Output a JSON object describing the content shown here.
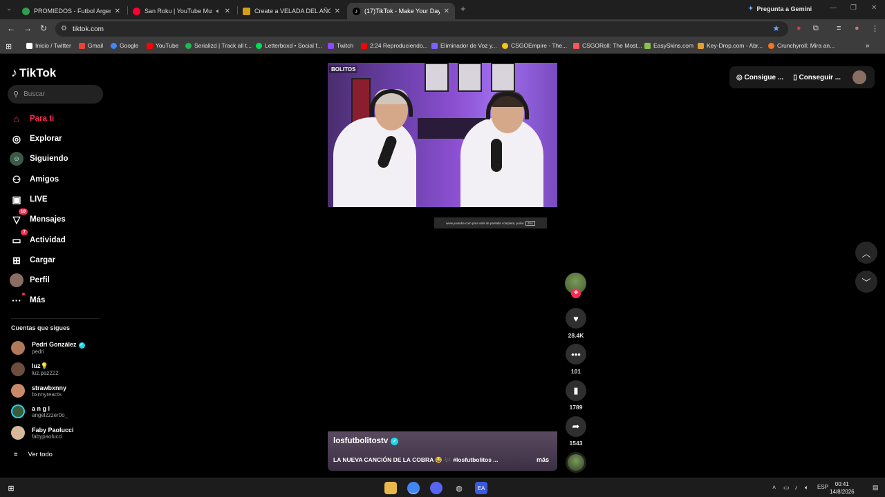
{
  "browser": {
    "tabs": [
      {
        "title": "PROMIEDOS - Futbol Argentino",
        "color": "#2e9e4f",
        "active": false
      },
      {
        "title": "San Roku | YouTube Music",
        "color": "#ff0033",
        "active": false
      },
      {
        "title": "Create a VELADA DEL AÑO #Pe",
        "color": "#d4a017",
        "active": false
      },
      {
        "title": "(17)TikTok - Make Your Day",
        "color": "#ffffff",
        "active": true
      }
    ],
    "new_tab": "+",
    "gemini_label": "Pregunta a Gemini",
    "url": "tiktok.com",
    "bookmarks": [
      {
        "label": "Inicio / Twitter",
        "color": "#ffffff"
      },
      {
        "label": "Gmail",
        "color": "#ea4335"
      },
      {
        "label": "Google",
        "color": "#4285f4"
      },
      {
        "label": "YouTube",
        "color": "#ff0000"
      },
      {
        "label": "Serializd | Track all t...",
        "color": "#1db954"
      },
      {
        "label": "Letterboxd • Social f...",
        "color": "#00e054"
      },
      {
        "label": "Twitch",
        "color": "#9146ff"
      },
      {
        "label": "2:24 Reproduciendo...",
        "color": "#ff0000"
      },
      {
        "label": "Eliminador de Voz y...",
        "color": "#7b61ff"
      },
      {
        "label": "CSGOEmpire - The...",
        "color": "#f5c518"
      },
      {
        "label": "CSGORoll: The Most...",
        "color": "#ff5555"
      },
      {
        "label": "EasySkins.com",
        "color": "#8bc34a"
      },
      {
        "label": "Key-Drop.com - Abr...",
        "color": "#e0a030"
      },
      {
        "label": "Crunchyroll: Mira an...",
        "color": "#f47521"
      }
    ]
  },
  "tiktok": {
    "logo": "TikTok",
    "search_placeholder": "Buscar",
    "nav": [
      {
        "label": "Para ti",
        "icon": "home-icon",
        "active": true
      },
      {
        "label": "Explorar",
        "icon": "compass-icon"
      },
      {
        "label": "Siguiendo",
        "icon": "following-icon"
      },
      {
        "label": "Amigos",
        "icon": "friends-icon"
      },
      {
        "label": "LIVE",
        "icon": "live-icon"
      },
      {
        "label": "Mensajes",
        "icon": "messages-icon",
        "badge": "10"
      },
      {
        "label": "Actividad",
        "icon": "activity-icon",
        "badge": "7"
      },
      {
        "label": "Cargar",
        "icon": "upload-icon"
      },
      {
        "label": "Perfil",
        "icon": "profile-icon"
      },
      {
        "label": "Más",
        "icon": "more-icon"
      }
    ],
    "following_title": "Cuentas que sigues",
    "following": [
      {
        "name": "Pedri González",
        "handle": "pedri",
        "verified": true,
        "color": "#b07a5a"
      },
      {
        "name": "luz💡",
        "handle": "luz.paz222",
        "verified": false,
        "color": "#6b4e3d"
      },
      {
        "name": "strawbxnny",
        "handle": "bxnnyreacts",
        "verified": false,
        "color": "#c98a6a"
      },
      {
        "name": "a n g l",
        "handle": "angelzzzer0o_",
        "verified": false,
        "color": "#3a5a3a"
      },
      {
        "name": "Faby Paolucci",
        "handle": "fabypaolucci",
        "verified": false,
        "color": "#d8b89a"
      }
    ],
    "see_all": "Ver todo",
    "video": {
      "watermark": "BOLITOS",
      "esc_hint": "www.youtube.com para salir de pantalla completa, pulsa",
      "esc_key": "Esc",
      "author": "losfutbolitostv",
      "caption": "LA NUEVA CANCIÓN DE LA COBRA 😂 🎶 #losfutbolitos ...",
      "more": "más",
      "likes": "28.4K",
      "comments": "101",
      "saves": "1789",
      "shares": "1543"
    },
    "topbar": {
      "coins": "Consigue ...",
      "app": "Conseguir ..."
    }
  },
  "taskbar": {
    "lang": "ESP",
    "time": "00:41",
    "date": "14/8/2026"
  }
}
